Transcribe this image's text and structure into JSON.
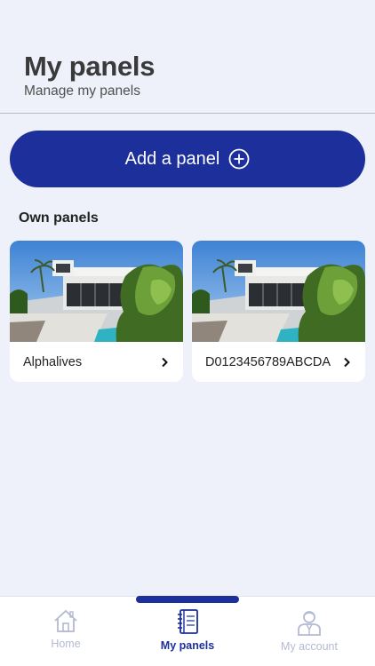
{
  "header": {
    "title": "My panels",
    "subtitle": "Manage my panels"
  },
  "add_button": {
    "label": "Add a panel",
    "icon": "plus-circle-icon"
  },
  "section": {
    "own_panels_label": "Own panels"
  },
  "panels": [
    {
      "name": "Alphalives"
    },
    {
      "name": "D0123456789ABCDA"
    }
  ],
  "tabbar": {
    "home": "Home",
    "my_panels": "My panels",
    "my_account": "My account",
    "active": "my_panels"
  },
  "colors": {
    "accent": "#1c2f9b",
    "background": "#eef1fa",
    "inactive_tab": "#b4bad2"
  }
}
